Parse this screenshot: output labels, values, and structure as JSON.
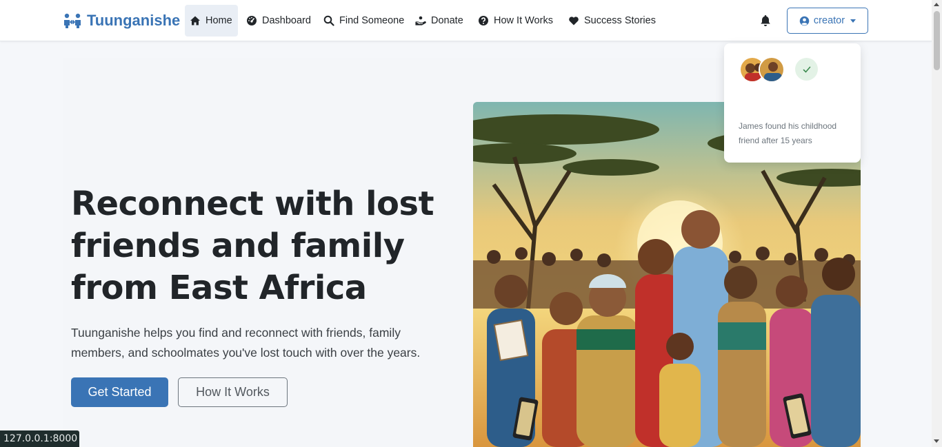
{
  "brand": {
    "name": "Tuunganishe",
    "icon": "people-arrows-icon",
    "color": "#3a74b5"
  },
  "nav": {
    "items": [
      {
        "label": "Home",
        "icon": "home-icon",
        "active": true
      },
      {
        "label": "Dashboard",
        "icon": "gauge-icon",
        "active": false
      },
      {
        "label": "Find Someone",
        "icon": "search-icon",
        "active": false
      },
      {
        "label": "Donate",
        "icon": "hand-holding-icon",
        "active": false
      },
      {
        "label": "How It Works",
        "icon": "question-circle-icon",
        "active": false
      },
      {
        "label": "Success Stories",
        "icon": "heart-icon",
        "active": false
      }
    ],
    "notifications_icon": "bell-icon",
    "user": {
      "label": "creator",
      "icon": "user-circle-icon"
    }
  },
  "hero": {
    "headline": "Reconnect with lost friends and family from East Africa",
    "lead": "Tuunganishe helps you find and reconnect with friends, family members, and schoolmates you've lost touch with over the years.",
    "primary_button": "Get Started",
    "secondary_button": "How It Works",
    "image_alt": "Joyful reunion scene under acacia trees"
  },
  "story_card": {
    "text": "James found his childhood friend after 15 years",
    "status_icon": "check-icon"
  },
  "status_bar": {
    "url": "127.0.0.1:8000"
  },
  "colors": {
    "primary": "#3a74b5",
    "text": "#212529",
    "muted": "#6c757d",
    "background": "#f5f7fa"
  }
}
